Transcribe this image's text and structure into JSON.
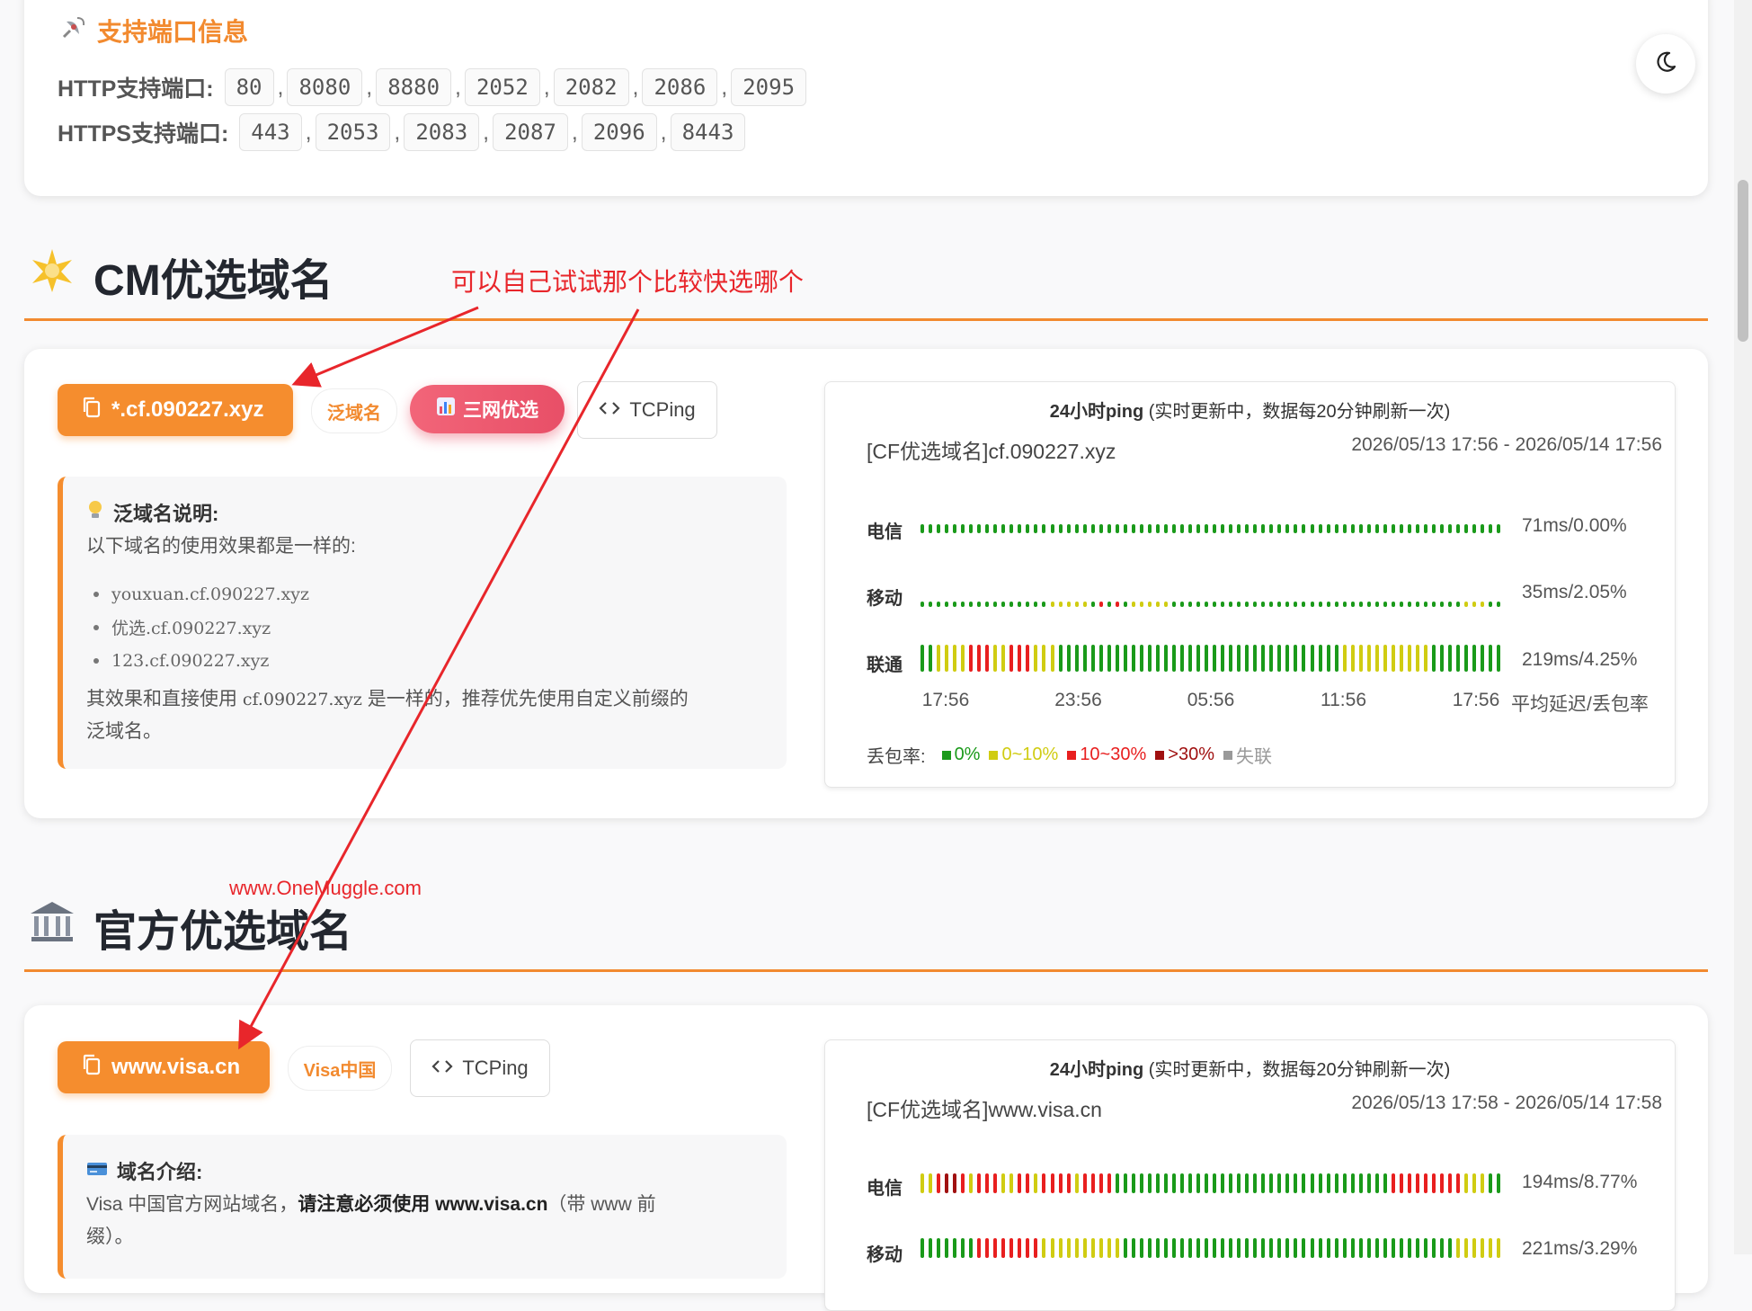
{
  "ports": {
    "title": "支持端口信息",
    "title_icon": "satellite-icon",
    "http_label": "HTTP支持端口:",
    "http_ports": [
      "80",
      "8080",
      "8880",
      "2052",
      "2082",
      "2086",
      "2095"
    ],
    "https_label": "HTTPS支持端口:",
    "https_ports": [
      "443",
      "2053",
      "2083",
      "2087",
      "2096",
      "8443"
    ]
  },
  "theme_toggle_icon": "moon-icon",
  "annotation": "可以自己试试那个比较快选哪个",
  "watermark": "www.OneMuggle.com",
  "colors": {
    "accent": "#f58d2e",
    "pink": "#e84f67",
    "ok": "#1a9a1a",
    "warn": "#d0cc12",
    "bad": "#e81f1f",
    "worse": "#a01010",
    "lost": "#999999",
    "annotation": "#e8262b"
  },
  "sections": [
    {
      "title": "CM优选域名",
      "icon": "sparkle-icon",
      "domain_button": "*.cf.090227.xyz",
      "tag": "泛域名",
      "three_button": "三网优选",
      "tcping": "TCPing",
      "note": {
        "icon": "lightbulb-icon",
        "title": "泛域名说明:",
        "line1": "以下域名的使用效果都是一样的:",
        "items": [
          "youxuan.cf.090227.xyz",
          "优选.cf.090227.xyz",
          "123.cf.090227.xyz"
        ],
        "line2a": "其效果和直接使用",
        "line2_code": "cf.090227.xyz",
        "line2b": "是一样的，推荐优先使用自定义前缀的",
        "line3": "泛域名。"
      },
      "ping": {
        "header_bold": "24小时ping",
        "header_rest": "(实时更新中，数据每20分钟刷新一次)",
        "name": "[CF优选域名]cf.090227.xyz",
        "time": "2026/05/13 17:56 - 2026/05/14 17:56",
        "rows": [
          {
            "label": "电信",
            "value": "71ms/0.00%"
          },
          {
            "label": "移动",
            "value": "35ms/2.05%"
          },
          {
            "label": "联通",
            "value": "219ms/4.25%"
          }
        ],
        "x_ticks": [
          "17:56",
          "23:56",
          "05:56",
          "11:56",
          "17:56"
        ],
        "x_end_label": "平均延迟/丢包率",
        "legend_label": "丢包率:",
        "legend": [
          {
            "label": "0%",
            "color": "#1a9a1a"
          },
          {
            "label": "0~10%",
            "color": "#d0cc12"
          },
          {
            "label": "10~30%",
            "color": "#e81f1f"
          },
          {
            "label": ">30%",
            "color": "#a01010"
          },
          {
            "label": "失联",
            "color": "#999999"
          }
        ]
      }
    },
    {
      "title": "官方优选域名",
      "icon": "bank-icon",
      "domain_button": "www.visa.cn",
      "tag": "Visa中国",
      "tcping": "TCPing",
      "note": {
        "icon": "credit-card-icon",
        "title": "域名介绍:",
        "text_a": "Visa 中国官方网站域名，",
        "text_bold": "请注意必须使用 www.visa.cn",
        "text_b": "（带 www 前",
        "text_c": "缀）。"
      },
      "ping": {
        "header_bold": "24小时ping",
        "header_rest": "(实时更新中，数据每20分钟刷新一次)",
        "name": "[CF优选域名]www.visa.cn",
        "time": "2026/05/13 17:58 - 2026/05/14 17:58",
        "rows": [
          {
            "label": "电信",
            "value": "194ms/8.77%"
          },
          {
            "label": "移动",
            "value": "221ms/3.29%"
          }
        ]
      }
    }
  ]
}
